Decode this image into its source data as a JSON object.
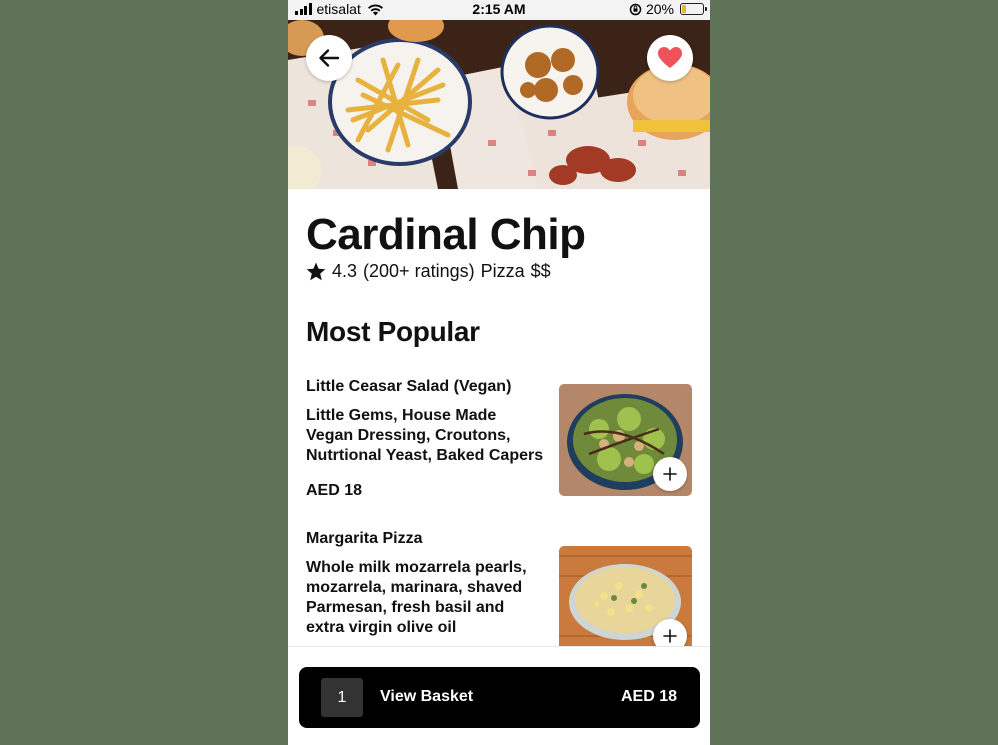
{
  "status_bar": {
    "carrier": "etisalat",
    "time": "2:15 AM",
    "battery": "20%",
    "battery_level": 0.2
  },
  "header": {
    "back_icon": "arrow-left-icon",
    "favorite_icon": "heart-icon",
    "favorite_color": "#f0525c"
  },
  "restaurant": {
    "name": "Cardinal Chip",
    "rating": "4.3",
    "ratings_count": "(200+ ratings)",
    "category": "Pizza",
    "price_level": "$$"
  },
  "section": {
    "title": "Most Popular"
  },
  "items": [
    {
      "name": "Little Ceasar Salad (Vegan)",
      "description": "Little Gems, House Made Vegan Dressing, Croutons, Nutrtional Yeast, Baked Capers",
      "price": "AED 18",
      "add_icon": "plus-icon"
    },
    {
      "name": "Margarita Pizza",
      "description": "Whole milk mozarrela pearls, mozarrela, marinara, shaved Parmesan, fresh basil and extra virgin olive oil",
      "add_icon": "plus-icon"
    }
  ],
  "basket": {
    "count": "1",
    "label": "View Basket",
    "total": "AED 18"
  }
}
